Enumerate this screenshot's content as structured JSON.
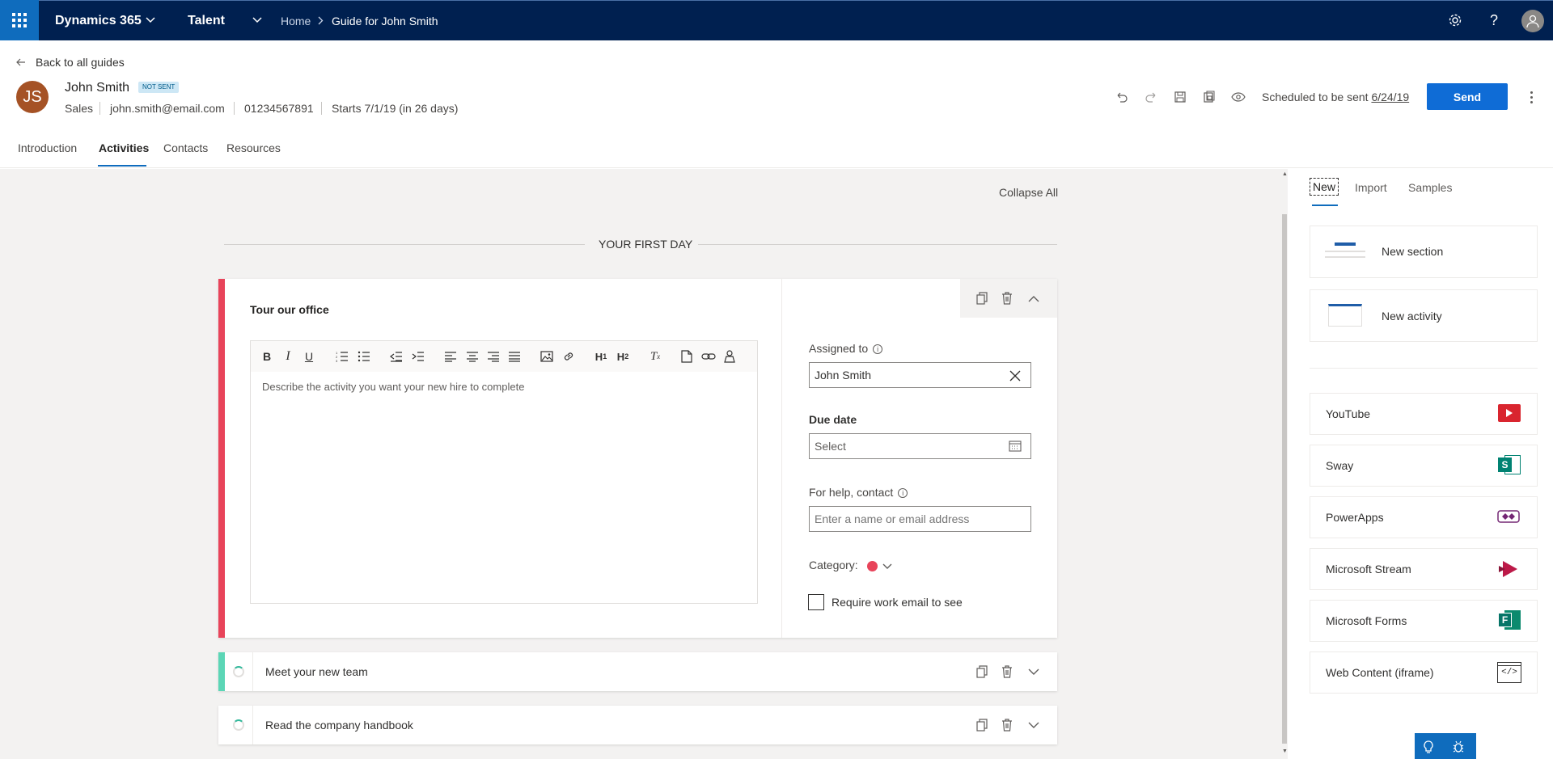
{
  "topbar": {
    "app_name": "Dynamics 365",
    "module": "Talent",
    "breadcrumb_home": "Home",
    "breadcrumb_current": "Guide for John Smith"
  },
  "header": {
    "back_link": "Back to all guides",
    "avatar_initials": "JS",
    "name": "John Smith",
    "status_badge": "NOT SENT",
    "department": "Sales",
    "email": "john.smith@email.com",
    "phone": "01234567891",
    "start": "Starts 7/1/19 (in 26 days)",
    "scheduled_prefix": "Scheduled to be sent",
    "scheduled_date": "6/24/19",
    "send_label": "Send"
  },
  "tabs": [
    {
      "label": "Introduction"
    },
    {
      "label": "Activities"
    },
    {
      "label": "Contacts"
    },
    {
      "label": "Resources"
    }
  ],
  "main": {
    "collapse_all": "Collapse All",
    "section_title": "YOUR FIRST DAY",
    "activity": {
      "title": "Tour our office",
      "description_placeholder": "Describe the activity you want your new hire to complete",
      "assigned_label": "Assigned to",
      "assigned_value": "John Smith",
      "due_label": "Due date",
      "due_placeholder": "Select",
      "help_label": "For help, contact",
      "help_placeholder": "Enter a name or email address",
      "category_label": "Category:",
      "require_email_label": "Require work email to see"
    },
    "collapsed_activities": [
      {
        "title": "Meet your new team",
        "accent": "#5cd6b6"
      },
      {
        "title": "Read the company handbook",
        "accent": ""
      }
    ]
  },
  "right_panel": {
    "tabs": [
      {
        "label": "New"
      },
      {
        "label": "Import"
      },
      {
        "label": "Samples"
      }
    ],
    "templates": [
      {
        "label": "New section"
      },
      {
        "label": "New activity"
      }
    ],
    "content_types": [
      {
        "label": "YouTube",
        "icon": "youtube-icon"
      },
      {
        "label": "Sway",
        "icon": "sway-icon"
      },
      {
        "label": "PowerApps",
        "icon": "powerapps-icon"
      },
      {
        "label": "Microsoft Stream",
        "icon": "stream-icon"
      },
      {
        "label": "Microsoft Forms",
        "icon": "forms-icon"
      },
      {
        "label": "Web Content (iframe)",
        "icon": "iframe-icon"
      }
    ]
  },
  "colors": {
    "topbar": "#002050",
    "accent_blue": "#0f6cbd",
    "activity_accent": "#e8445a",
    "category_dot": "#e8445a"
  }
}
